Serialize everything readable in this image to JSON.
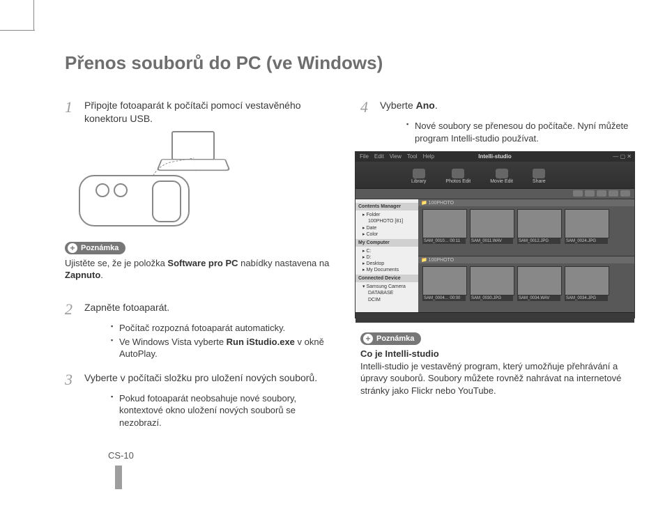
{
  "title": "Přenos souborů do PC (ve Windows)",
  "steps": {
    "s1": {
      "num": "1",
      "body": "Připojte fotoaparát k počítači pomocí vestavěného konektoru USB."
    },
    "s2": {
      "num": "2",
      "body": "Zapněte fotoaparát.",
      "bul1": "Počítač rozpozná fotoaparát automaticky.",
      "bul2_a": "Ve Windows Vista vyberte ",
      "bul2_b": "Run iStudio.exe",
      "bul2_c": " v okně AutoPlay."
    },
    "s3": {
      "num": "3",
      "body": "Vyberte v počítači složku pro uložení nových souborů.",
      "bul1": "Pokud fotoaparát neobsahuje nové soubory, kontextové okno uložení nových souborů se nezobrazí."
    },
    "s4": {
      "num": "4",
      "body_a": "Vyberte ",
      "body_b": "Ano",
      "body_c": ".",
      "bul1": "Nové soubory se přenesou do počítače. Nyní můžete program Intelli-studio používat."
    }
  },
  "notes": {
    "label": "Poznámka",
    "n1_a": "Ujistěte se, že je položka ",
    "n1_b": "Software pro PC",
    "n1_c": " nabídky nastavena na ",
    "n1_d": "Zapnuto",
    "n1_e": ".",
    "n2_head": "Co je Intelli-studio",
    "n2_body": "Intelli-studio je vestavěný program, který umožňuje přehrávání a úpravy souborů. Soubory můžete rovněž nahrávat na internetové stránky jako Flickr nebo YouTube."
  },
  "app": {
    "title": "Intelli-studio",
    "menu": {
      "m1": "File",
      "m2": "Edit",
      "m3": "View",
      "m4": "Tool",
      "m5": "Help"
    },
    "tabs": {
      "t1": "Library",
      "t2": "Photos Edit",
      "t3": "Movie Edit",
      "t4": "Share"
    },
    "side": {
      "h1": "Contents Manager",
      "r1": "Folder",
      "r1a": "100PHOTO",
      "r1a_count": "[81]",
      "r2": "Date",
      "r3": "Color",
      "h2": "My Computer",
      "c1": "C:",
      "c2": "D:",
      "c3": "Desktop",
      "c4": "My Documents",
      "h3": "Connected Device",
      "d1": "Samsung Camera",
      "d2": "DATABASE",
      "d3": "DCIM"
    },
    "panes": {
      "p1": "100PHOTO",
      "p2": "100PHOTO"
    },
    "thumbs": {
      "a1": "SAM_0010… 00:11",
      "a2": "SAM_0011.WAV",
      "a3": "SAM_0012.JPG",
      "a4": "SAM_0024.JPG",
      "b1": "SAM_0004… 00:00",
      "b2": "SAM_0030.JPG",
      "b3": "SAM_0034.WAV",
      "b4": "SAM_0034.JPG"
    }
  },
  "page_number": "CS-10"
}
